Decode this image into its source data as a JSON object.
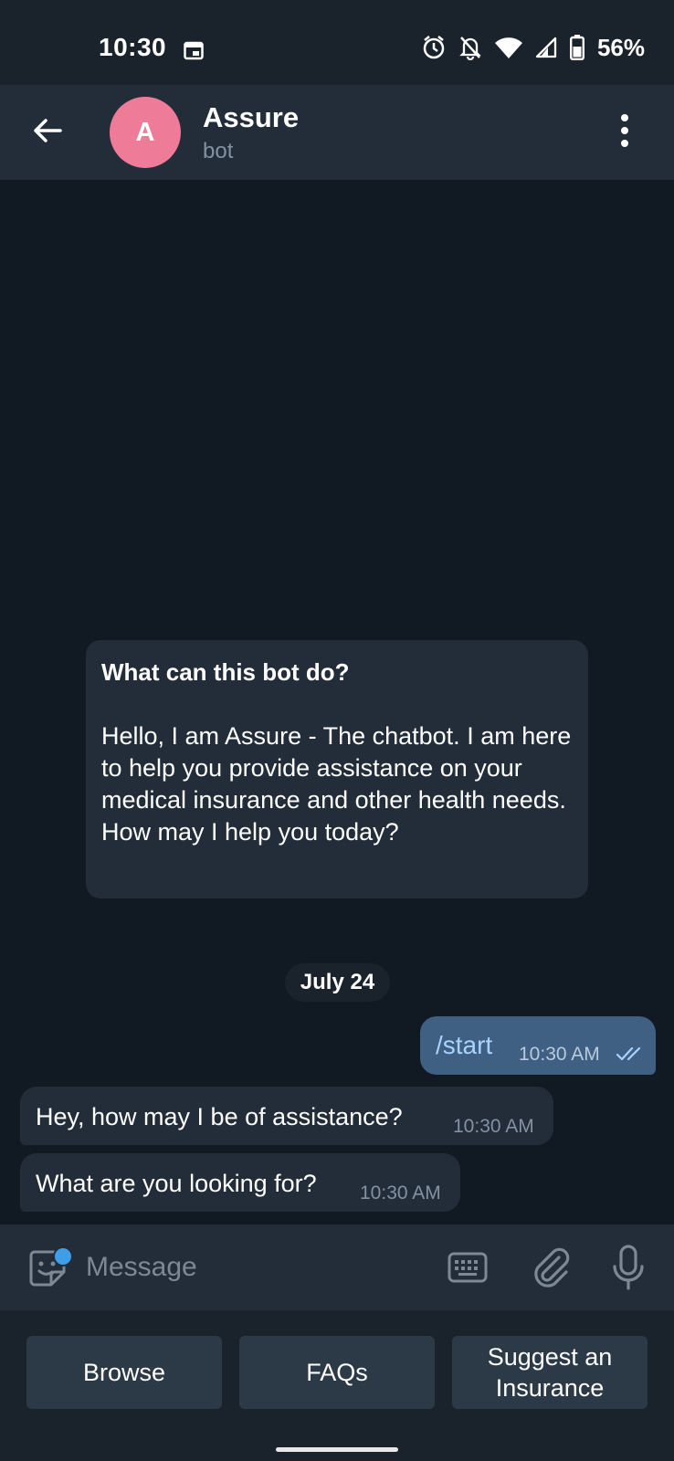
{
  "status_bar": {
    "time": "10:30",
    "battery": "56%"
  },
  "header": {
    "avatar_letter": "A",
    "title": "Assure",
    "subtitle": "bot"
  },
  "intro_card": {
    "title": "What can this bot do?",
    "body": "Hello, I am Assure - The chatbot. I am here to help you provide assistance on your medical insurance and other health needs. How may I help you today?"
  },
  "date_separator": "July 24",
  "messages": [
    {
      "direction": "outgoing",
      "text": "/start",
      "time": "10:30 AM",
      "read": true
    },
    {
      "direction": "incoming",
      "text": "Hey, how may I be of assistance?",
      "time": "10:30 AM"
    },
    {
      "direction": "incoming",
      "text": "What are you looking for?",
      "time": "10:30 AM"
    }
  ],
  "composer": {
    "placeholder": "Message"
  },
  "reply_keyboard": {
    "buttons": [
      {
        "label": "Browse"
      },
      {
        "label": "FAQs"
      },
      {
        "label": "Suggest an Insurance"
      }
    ]
  },
  "colors": {
    "background": "#111922",
    "header": "#222d39",
    "avatar": "#ee7b97",
    "outgoing_bubble": "#3f5f83",
    "incoming_bubble": "#222d39",
    "accent": "#3e9ee8"
  },
  "icons": [
    "calendar-icon",
    "alarm-icon",
    "bell-off-icon",
    "wifi-icon",
    "signal-icon",
    "battery-icon",
    "back-arrow-icon",
    "more-vert-icon",
    "sticker-icon",
    "keyboard-icon",
    "attach-icon",
    "mic-icon",
    "read-ticks-icon"
  ]
}
